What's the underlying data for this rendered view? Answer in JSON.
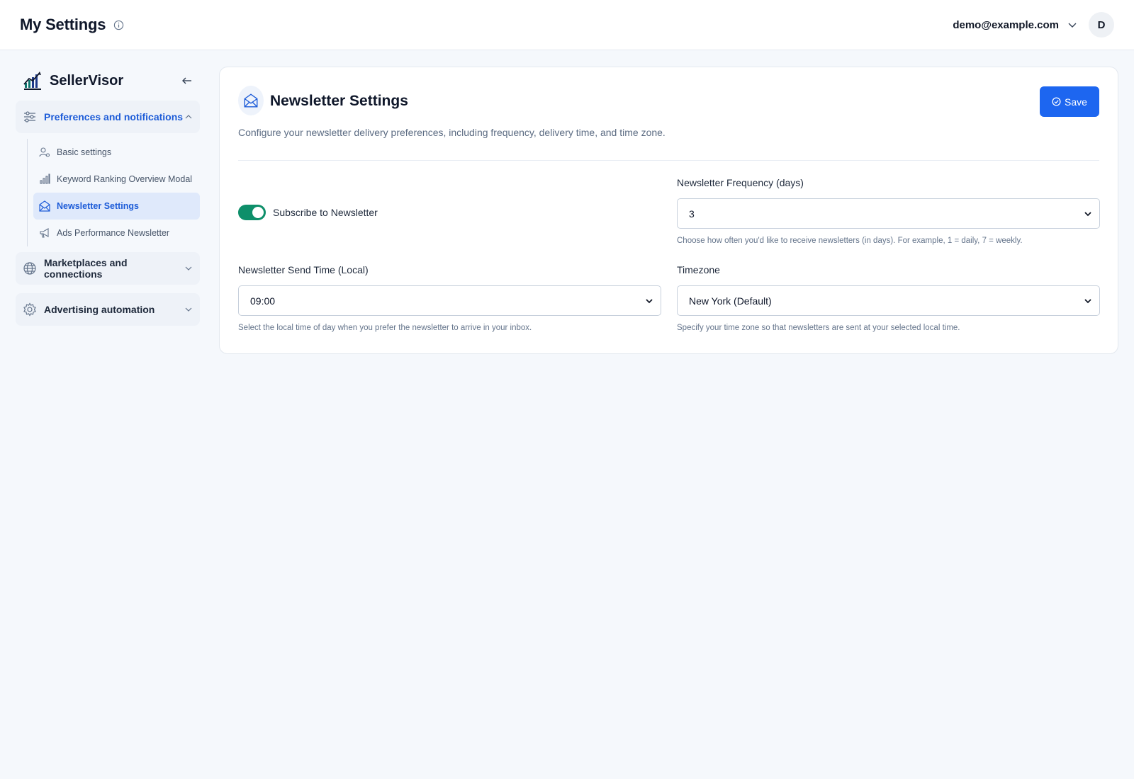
{
  "header": {
    "title": "My Settings",
    "user_email": "demo@example.com",
    "avatar_initial": "D"
  },
  "sidebar": {
    "brand_name": "SellerVisor",
    "groups": [
      {
        "label": "Preferences and notifications",
        "expanded": true,
        "items": [
          {
            "label": "Basic settings",
            "icon": "user-gear-icon"
          },
          {
            "label": "Keyword Ranking Overview Modal",
            "icon": "bar-chart-icon"
          },
          {
            "label": "Newsletter Settings",
            "icon": "mail-open-icon",
            "active": true
          },
          {
            "label": "Ads Performance Newsletter",
            "icon": "megaphone-icon"
          }
        ]
      },
      {
        "label": "Marketplaces and connections",
        "expanded": false
      },
      {
        "label": "Advertising automation",
        "expanded": false
      }
    ]
  },
  "main": {
    "title": "Newsletter Settings",
    "description": "Configure your newsletter delivery preferences, including frequency, delivery time, and time zone.",
    "save_label": "Save",
    "subscribe": {
      "label": "Subscribe to Newsletter",
      "checked": true
    },
    "frequency": {
      "label": "Newsletter Frequency (days)",
      "value": "3",
      "help": "Choose how often you'd like to receive newsletters (in days). For example, 1 = daily, 7 = weekly."
    },
    "send_time": {
      "label": "Newsletter Send Time (Local)",
      "value": "09:00",
      "help": "Select the local time of day when you prefer the newsletter to arrive in your inbox."
    },
    "timezone": {
      "label": "Timezone",
      "value": "New York (Default)",
      "help": "Specify your time zone so that newsletters are sent at your selected local time."
    }
  },
  "colors": {
    "accent": "#1d66f0",
    "active_text": "#1d5cd8",
    "toggle_on": "#0e8f6a",
    "background": "#f5f8fc"
  }
}
